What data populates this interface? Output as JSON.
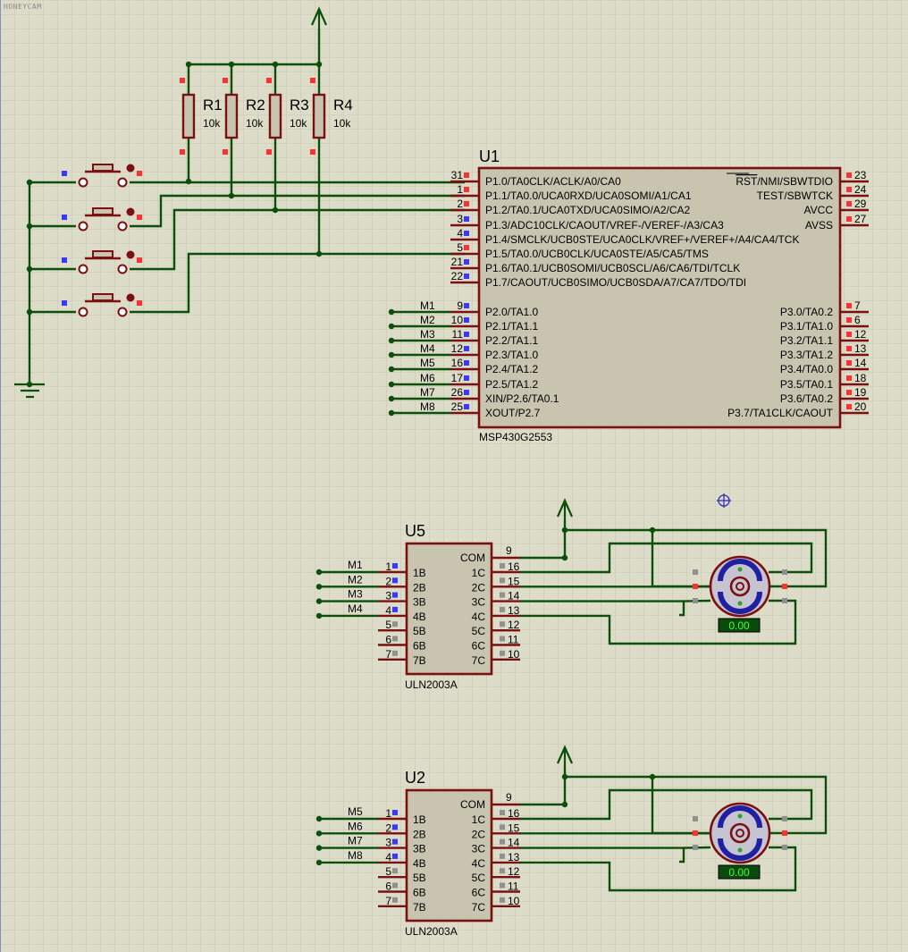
{
  "watermark": "HONEYCAM",
  "resistors": [
    {
      "ref": "R1",
      "value": "10k"
    },
    {
      "ref": "R2",
      "value": "10k"
    },
    {
      "ref": "R3",
      "value": "10k"
    },
    {
      "ref": "R4",
      "value": "10k"
    }
  ],
  "mcu": {
    "ref": "U1",
    "part": "MSP430G2553",
    "left_pins": [
      {
        "num": "31",
        "name": "P1.0/TA0CLK/ACLK/A0/CA0"
      },
      {
        "num": "1",
        "name": "P1.1/TA0.0/UCA0RXD/UCA0SOMI/A1/CA1"
      },
      {
        "num": "2",
        "name": "P1.2/TA0.1/UCA0TXD/UCA0SIMO/A2/CA2"
      },
      {
        "num": "3",
        "name": "P1.3/ADC10CLK/CAOUT/VREF-/VEREF-/A3/CA3"
      },
      {
        "num": "4",
        "name": "P1.4/SMCLK/UCB0STE/UCA0CLK/VREF+/VEREF+/A4/CA4/TCK"
      },
      {
        "num": "5",
        "name": "P1.5/TA0.0/UCB0CLK/UCA0STE/A5/CA5/TMS"
      },
      {
        "num": "21",
        "name": "P1.6/TA0.1/UCB0SOMI/UCB0SCL/A6/CA6/TDI/TCLK"
      },
      {
        "num": "22",
        "name": "P1.7/CAOUT/UCB0SIMO/UCB0SDA/A7/CA7/TDO/TDI"
      },
      {
        "num": "9",
        "name": "P2.0/TA1.0",
        "net": "M1"
      },
      {
        "num": "10",
        "name": "P2.1/TA1.1",
        "net": "M2"
      },
      {
        "num": "11",
        "name": "P2.2/TA1.1",
        "net": "M3"
      },
      {
        "num": "12",
        "name": "P2.3/TA1.0",
        "net": "M4"
      },
      {
        "num": "16",
        "name": "P2.4/TA1.2",
        "net": "M5"
      },
      {
        "num": "17",
        "name": "P2.5/TA1.2",
        "net": "M6"
      },
      {
        "num": "26",
        "name": "XIN/P2.6/TA0.1",
        "net": "M7"
      },
      {
        "num": "25",
        "name": "XOUT/P2.7",
        "net": "M8"
      }
    ],
    "right_pins": [
      {
        "num": "23",
        "name": "NMI/SBWTDIO",
        "overbar": "RST"
      },
      {
        "num": "24",
        "name": "TEST/SBWTCK"
      },
      {
        "num": "29",
        "name": "AVCC"
      },
      {
        "num": "27",
        "name": "AVSS"
      },
      {
        "num": "7",
        "name": "P3.0/TA0.2"
      },
      {
        "num": "6",
        "name": "P3.1/TA1.0"
      },
      {
        "num": "12",
        "name": "P3.2/TA1.1"
      },
      {
        "num": "13",
        "name": "P3.3/TA1.2"
      },
      {
        "num": "14",
        "name": "P3.4/TA0.0"
      },
      {
        "num": "18",
        "name": "P3.5/TA0.1"
      },
      {
        "num": "19",
        "name": "P3.6/TA0.2"
      },
      {
        "num": "20",
        "name": "P3.7/TA1CLK/CAOUT"
      }
    ]
  },
  "drivers": [
    {
      "ref": "U5",
      "part": "ULN2003A",
      "com_label": "COM",
      "com_pin": "9",
      "inputs": [
        {
          "num": "1",
          "name": "1B",
          "net": "M1"
        },
        {
          "num": "2",
          "name": "2B",
          "net": "M2"
        },
        {
          "num": "3",
          "name": "3B",
          "net": "M3"
        },
        {
          "num": "4",
          "name": "4B",
          "net": "M4"
        },
        {
          "num": "5",
          "name": "5B"
        },
        {
          "num": "6",
          "name": "6B"
        },
        {
          "num": "7",
          "name": "7B"
        }
      ],
      "outputs": [
        {
          "num": "16",
          "name": "1C"
        },
        {
          "num": "15",
          "name": "2C"
        },
        {
          "num": "14",
          "name": "3C"
        },
        {
          "num": "13",
          "name": "4C"
        },
        {
          "num": "12",
          "name": "5C"
        },
        {
          "num": "11",
          "name": "6C"
        },
        {
          "num": "10",
          "name": "7C"
        }
      ],
      "motor_readout": "0.00"
    },
    {
      "ref": "U2",
      "part": "ULN2003A",
      "com_label": "COM",
      "com_pin": "9",
      "inputs": [
        {
          "num": "1",
          "name": "1B",
          "net": "M5"
        },
        {
          "num": "2",
          "name": "2B",
          "net": "M6"
        },
        {
          "num": "3",
          "name": "3B",
          "net": "M7"
        },
        {
          "num": "4",
          "name": "4B",
          "net": "M8"
        },
        {
          "num": "5",
          "name": "5B"
        },
        {
          "num": "6",
          "name": "6B"
        },
        {
          "num": "7",
          "name": "7B"
        }
      ],
      "outputs": [
        {
          "num": "16",
          "name": "1C"
        },
        {
          "num": "15",
          "name": "2C"
        },
        {
          "num": "14",
          "name": "3C"
        },
        {
          "num": "13",
          "name": "4C"
        },
        {
          "num": "12",
          "name": "5C"
        },
        {
          "num": "11",
          "name": "6C"
        },
        {
          "num": "10",
          "name": "7C"
        }
      ],
      "motor_readout": "0.00"
    }
  ],
  "colors": {
    "background": "#dcdcc8",
    "grid": "#c8c8b4",
    "wire": "#0b4f0b",
    "component": "#7a1010",
    "body_fill": "#c8c4b0",
    "text": "#000000",
    "pin_blue": "#3838ff",
    "pin_red": "#ff3030",
    "pin_gray": "#909090",
    "readout_bg": "#0a4a0a",
    "readout_text": "#40ff40"
  }
}
